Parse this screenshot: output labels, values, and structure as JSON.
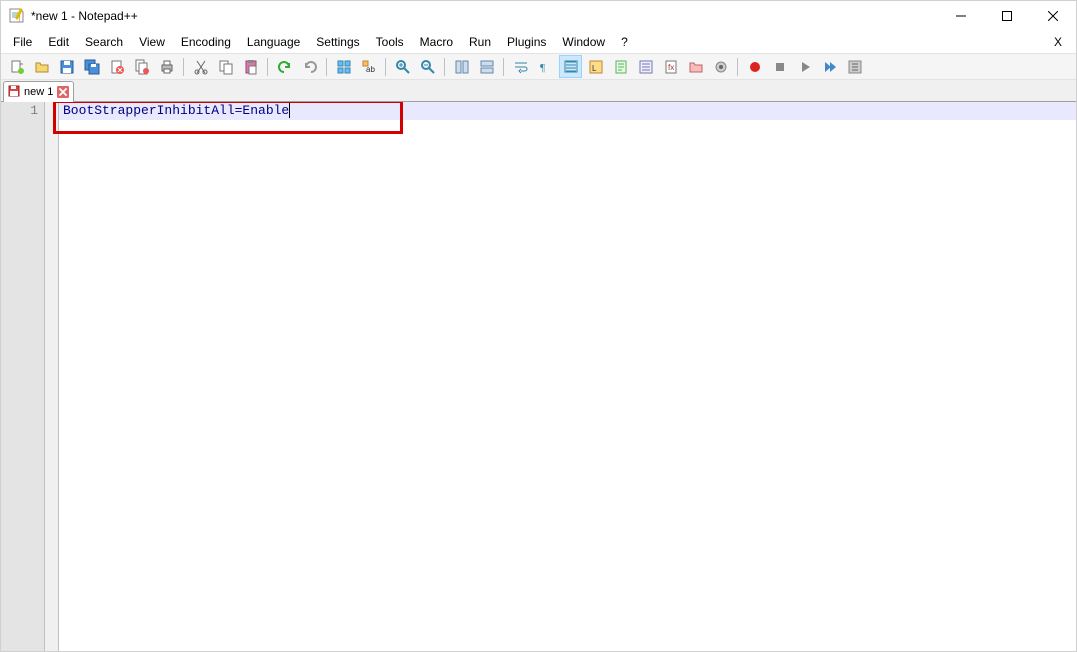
{
  "window": {
    "title": "*new 1 - Notepad++"
  },
  "menu": {
    "items": [
      "File",
      "Edit",
      "Search",
      "View",
      "Encoding",
      "Language",
      "Settings",
      "Tools",
      "Macro",
      "Run",
      "Plugins",
      "Window",
      "?"
    ],
    "right": "X"
  },
  "tabs": [
    {
      "label": "new 1"
    }
  ],
  "editor": {
    "lines": [
      "BootStrapperInhibitAll=Enable"
    ],
    "line_numbers": [
      "1"
    ]
  }
}
